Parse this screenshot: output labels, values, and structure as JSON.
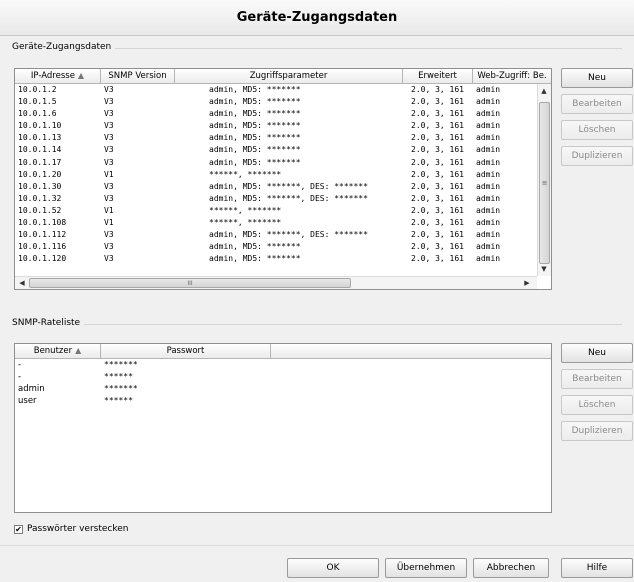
{
  "window": {
    "title": "Geräte-Zugangsdaten"
  },
  "access_group": {
    "label": "Geräte-Zugangsdaten",
    "columns": [
      "IP-Adresse",
      "SNMP Version",
      "Zugriffsparameter",
      "Erweitert",
      "Web-Zugriff: Be."
    ],
    "sort_icon": "sort-ascending-icon",
    "rows": [
      [
        "10.0.1.2",
        "V3",
        "admin, MD5: *******",
        "2.0, 3, 161",
        "admin"
      ],
      [
        "10.0.1.5",
        "V3",
        "admin, MD5: *******",
        "2.0, 3, 161",
        "admin"
      ],
      [
        "10.0.1.6",
        "V3",
        "admin, MD5: *******",
        "2.0, 3, 161",
        "admin"
      ],
      [
        "10.0.1.10",
        "V3",
        "admin, MD5: *******",
        "2.0, 3, 161",
        "admin"
      ],
      [
        "10.0.1.13",
        "V3",
        "admin, MD5: *******",
        "2.0, 3, 161",
        "admin"
      ],
      [
        "10.0.1.14",
        "V3",
        "admin, MD5: *******",
        "2.0, 3, 161",
        "admin"
      ],
      [
        "10.0.1.17",
        "V3",
        "admin, MD5: *******",
        "2.0, 3, 161",
        "admin"
      ],
      [
        "10.0.1.20",
        "V1",
        "******, *******",
        "2.0, 3, 161",
        "admin"
      ],
      [
        "10.0.1.30",
        "V3",
        "admin, MD5: *******, DES: *******",
        "2.0, 3, 161",
        "admin"
      ],
      [
        "10.0.1.32",
        "V3",
        "admin, MD5: *******, DES: *******",
        "2.0, 3, 161",
        "admin"
      ],
      [
        "10.0.1.52",
        "V1",
        "******, *******",
        "2.0, 3, 161",
        "admin"
      ],
      [
        "10.0.1.108",
        "V1",
        "******, *******",
        "2.0, 3, 161",
        "admin"
      ],
      [
        "10.0.1.112",
        "V3",
        "admin, MD5: *******, DES: *******",
        "2.0, 3, 161",
        "admin"
      ],
      [
        "10.0.1.116",
        "V3",
        "admin, MD5: *******",
        "2.0, 3, 161",
        "admin"
      ],
      [
        "10.0.1.120",
        "V3",
        "admin, MD5: *******",
        "2.0, 3, 161",
        "admin"
      ]
    ],
    "scroll_grip": "≡",
    "hscroll_grip": "III",
    "buttons": {
      "new": "Neu",
      "edit": "Bearbeiten",
      "delete": "Löschen",
      "duplicate": "Duplizieren"
    }
  },
  "snmp_group": {
    "label": "SNMP-Rateliste",
    "columns": [
      "Benutzer",
      "Passwort"
    ],
    "rows": [
      [
        "-",
        "*******"
      ],
      [
        "-",
        "******"
      ],
      [
        "admin",
        "*******"
      ],
      [
        "user",
        "******"
      ]
    ],
    "buttons": {
      "new": "Neu",
      "edit": "Bearbeiten",
      "delete": "Löschen",
      "duplicate": "Duplizieren"
    }
  },
  "hide_passwords": {
    "label": "Passwörter verstecken",
    "checked": true
  },
  "footer": {
    "ok": "OK",
    "apply": "Übernehmen",
    "cancel": "Abbrechen",
    "help": "Hilfe"
  }
}
